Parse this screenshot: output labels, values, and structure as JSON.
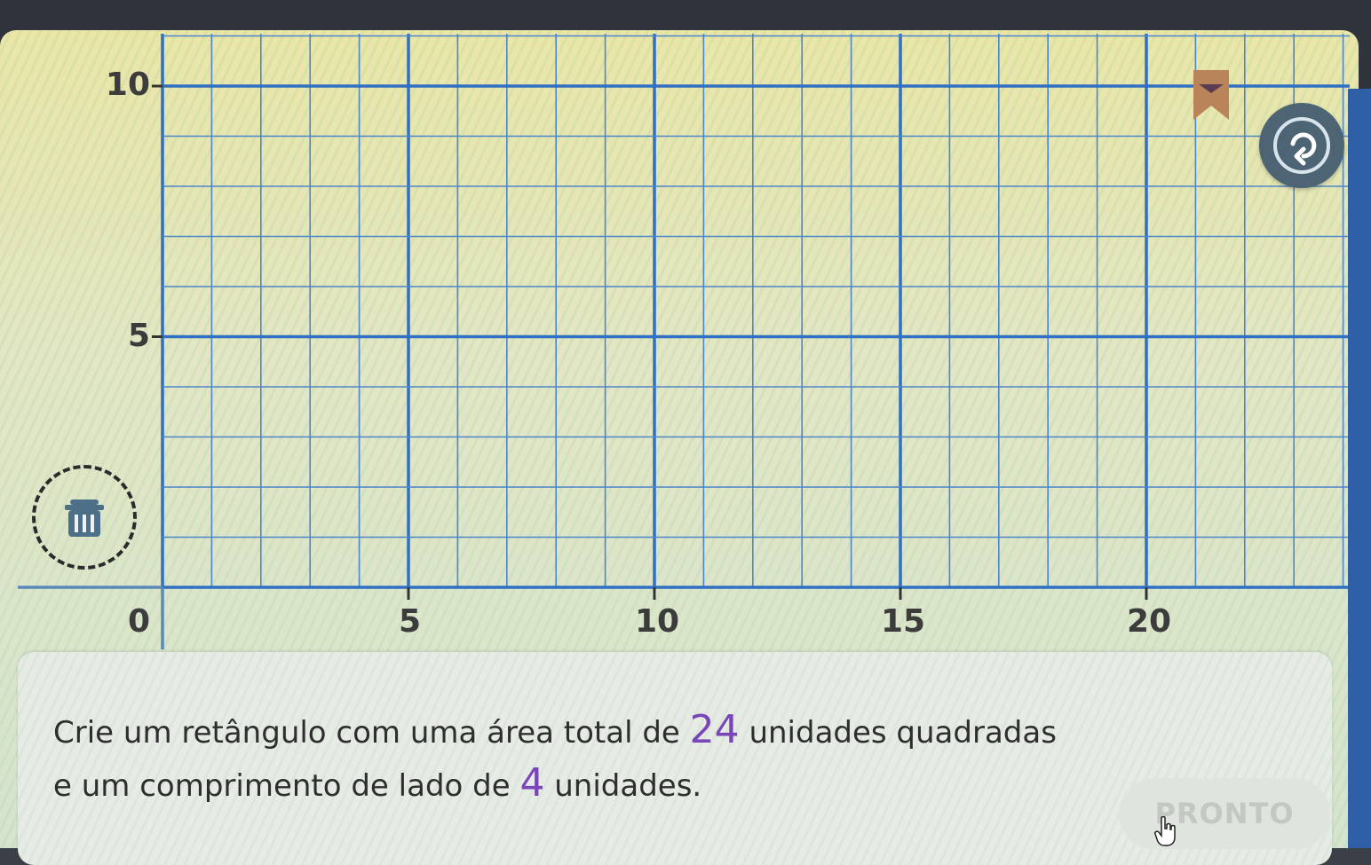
{
  "grid": {
    "y_labels": [
      {
        "value": 10,
        "label": "10"
      },
      {
        "value": 5,
        "label": "5"
      },
      {
        "value": 0,
        "label": "0"
      }
    ],
    "x_labels": [
      {
        "value": 5,
        "label": "5"
      },
      {
        "value": 10,
        "label": "10"
      },
      {
        "value": 15,
        "label": "15"
      },
      {
        "value": 20,
        "label": "20"
      }
    ],
    "x_range": [
      0,
      24
    ],
    "y_range": [
      0,
      10
    ],
    "minor_step": 1,
    "major_step": 5,
    "colors": {
      "minor_line": "#4d86c9",
      "major_line": "#2f6fc4",
      "axis": "#5a88b8"
    }
  },
  "toolbar": {
    "bookmark_icon": "bookmark-icon",
    "reset_icon": "reset-icon",
    "trash_icon": "trash-icon"
  },
  "prompt": {
    "line1_before": "Crie um retângulo com uma área total de ",
    "line1_number": "24",
    "line1_after": " unidades quadradas",
    "line2_before": "e um comprimento de lado de ",
    "line2_number": "4",
    "line2_after": " unidades.",
    "number_color": "#7a45b8"
  },
  "done_button": {
    "label": "PRONTO",
    "state": "disabled"
  }
}
